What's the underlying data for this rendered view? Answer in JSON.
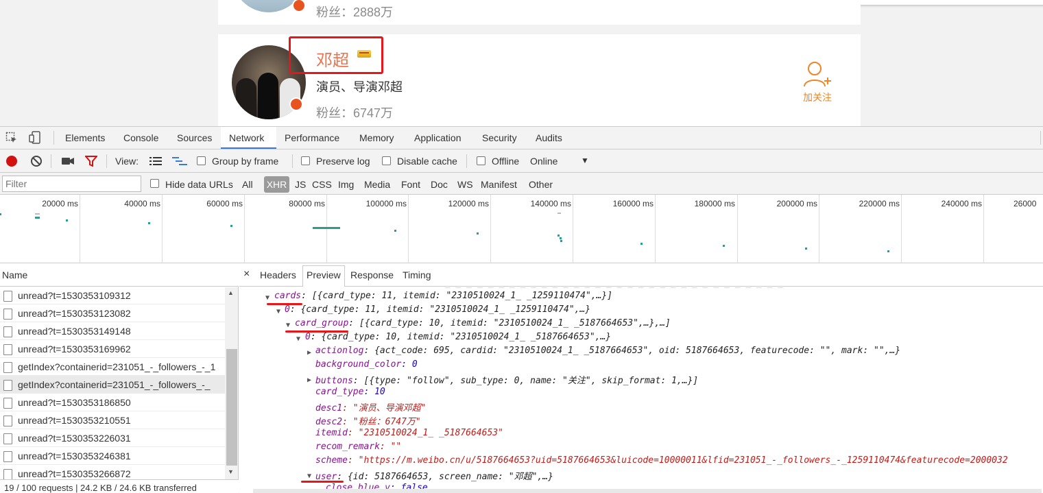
{
  "page": {
    "prev_card": {
      "fans": "粉丝：2888万"
    },
    "main_card": {
      "name": "邓超",
      "desc": "演员、导演邓超",
      "fans": "粉丝：6747万",
      "follow_label": "加关注"
    }
  },
  "devtools": {
    "tabs": [
      "Elements",
      "Console",
      "Sources",
      "Network",
      "Performance",
      "Memory",
      "Application",
      "Security",
      "Audits"
    ],
    "active_tab": "Network",
    "toolbar": {
      "view_label": "View:",
      "group_by_frame": "Group by frame",
      "preserve_log": "Preserve log",
      "disable_cache": "Disable cache",
      "offline": "Offline",
      "throttle": "Online"
    },
    "filter": {
      "placeholder": "Filter",
      "hide_data_urls": "Hide data URLs",
      "types": [
        "All",
        "XHR",
        "JS",
        "CSS",
        "Img",
        "Media",
        "Font",
        "Doc",
        "WS",
        "Manifest",
        "Other"
      ],
      "active_type": "XHR"
    },
    "timeline_ticks": [
      "20000 ms",
      "40000 ms",
      "60000 ms",
      "80000 ms",
      "100000 ms",
      "120000 ms",
      "140000 ms",
      "160000 ms",
      "180000 ms",
      "200000 ms",
      "220000 ms",
      "240000 ms",
      "26000"
    ],
    "name_header": "Name",
    "requests": [
      "unread?t=1530353109312",
      "unread?t=1530353123082",
      "unread?t=1530353149148",
      "unread?t=1530353169962",
      "getIndex?containerid=231051_-_followers_-_1",
      "getIndex?containerid=231051_-_followers_-_",
      "unread?t=1530353186850",
      "unread?t=1530353210551",
      "unread?t=1530353226031",
      "unread?t=1530353246381",
      "unread?t=1530353266872"
    ],
    "status": "19 / 100 requests | 24.2 KB / 24.6 KB transferred",
    "detail_tabs": [
      "Headers",
      "Preview",
      "Response",
      "Timing"
    ],
    "active_detail_tab": "Preview",
    "preview": [
      {
        "key": "cards",
        "rest": ": [{card_type: 11, itemid: \"2310510024_1_ _1259110474\",…}]"
      },
      {
        "key": "0",
        "rest": ": {card_type: 11, itemid: \"2310510024_1_ _1259110474\",…}"
      },
      {
        "key": "card_group",
        "rest": ": [{card_type: 10, itemid: \"2310510024_1_ _5187664653\",…},…]"
      },
      {
        "key": "0",
        "rest": ": {card_type: 10, itemid: \"2310510024_1_ _5187664653\",…}"
      },
      {
        "key": "actionlog",
        "rest": ": {act_code: 695, cardid: \"2310510024_1_ _5187664653\", oid: 5187664653, featurecode: \"\", mark: \"\",…}"
      },
      {
        "key": "background_color",
        "rest": ": 0"
      },
      {
        "key": "buttons",
        "rest": ": [{type: \"follow\", sub_type: 0, name: \"关注\", skip_format: 1,…}]"
      },
      {
        "key": "card_type",
        "rest": ": 10"
      },
      {
        "key": "desc1",
        "rest": ": \"演员、导演邓超\""
      },
      {
        "key": "desc2",
        "rest": ": \"粉丝：6747万\""
      },
      {
        "key": "itemid",
        "rest": ": \"2310510024_1_ _5187664653\""
      },
      {
        "key": "recom_remark",
        "rest": ": \"\""
      },
      {
        "key": "scheme",
        "rest": ": \"https://m.weibo.cn/u/5187664653?uid=5187664653&luicode=10000011&lfid=231051_-_followers_-_1259110474&featurecode=2000032"
      },
      {
        "key": "user",
        "rest": ": {id: 5187664653, screen_name: \"邓超\",…}"
      },
      {
        "key": "close_blue_v",
        "rest": ": false"
      }
    ],
    "colors": {
      "accent": "#3879d9",
      "annotation_red": "#e8161b",
      "record_red": "#d31111",
      "follow_orange": "#f08527"
    }
  }
}
